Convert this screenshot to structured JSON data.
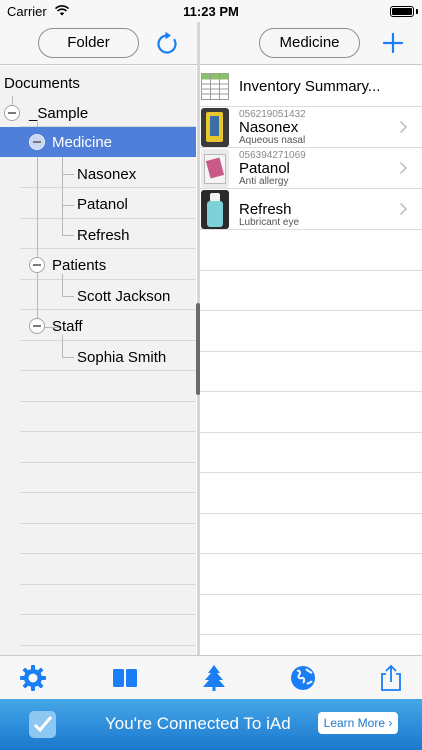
{
  "status_bar": {
    "carrier": "Carrier",
    "time": "11:23 PM"
  },
  "nav": {
    "left_button": "Folder",
    "right_button": "Medicine"
  },
  "tree": {
    "root": "Documents",
    "items": [
      {
        "label": "_Sample",
        "level": 1
      },
      {
        "label": "Medicine",
        "level": 2,
        "selected": true
      },
      {
        "label": "Nasonex",
        "level": 3
      },
      {
        "label": "Patanol",
        "level": 3
      },
      {
        "label": "Refresh",
        "level": 3
      },
      {
        "label": "Patients",
        "level": 2
      },
      {
        "label": "Scott Jackson",
        "level": 3
      },
      {
        "label": "Staff",
        "level": 2
      },
      {
        "label": "Sophia Smith",
        "level": 3
      }
    ]
  },
  "list": {
    "summary": "Inventory Summary...",
    "items": [
      {
        "code": "056219051432",
        "title": "Nasonex",
        "subtitle": "Aqueous nasal"
      },
      {
        "code": "056394271069",
        "title": "Patanol",
        "subtitle": "Anti allergy"
      },
      {
        "code": "",
        "title": "Refresh",
        "subtitle": "Lubricant eye"
      }
    ]
  },
  "tabbar": {
    "icons": [
      "gear-icon",
      "book-icon",
      "tree-icon",
      "globe-icon",
      "share-icon"
    ]
  },
  "ad": {
    "text": "You're Connected To iAd",
    "button": "Learn More ›"
  },
  "colors": {
    "accent": "#1a7ef5",
    "selection": "#4f7fd8",
    "ad_blue": "#1b78cf"
  }
}
